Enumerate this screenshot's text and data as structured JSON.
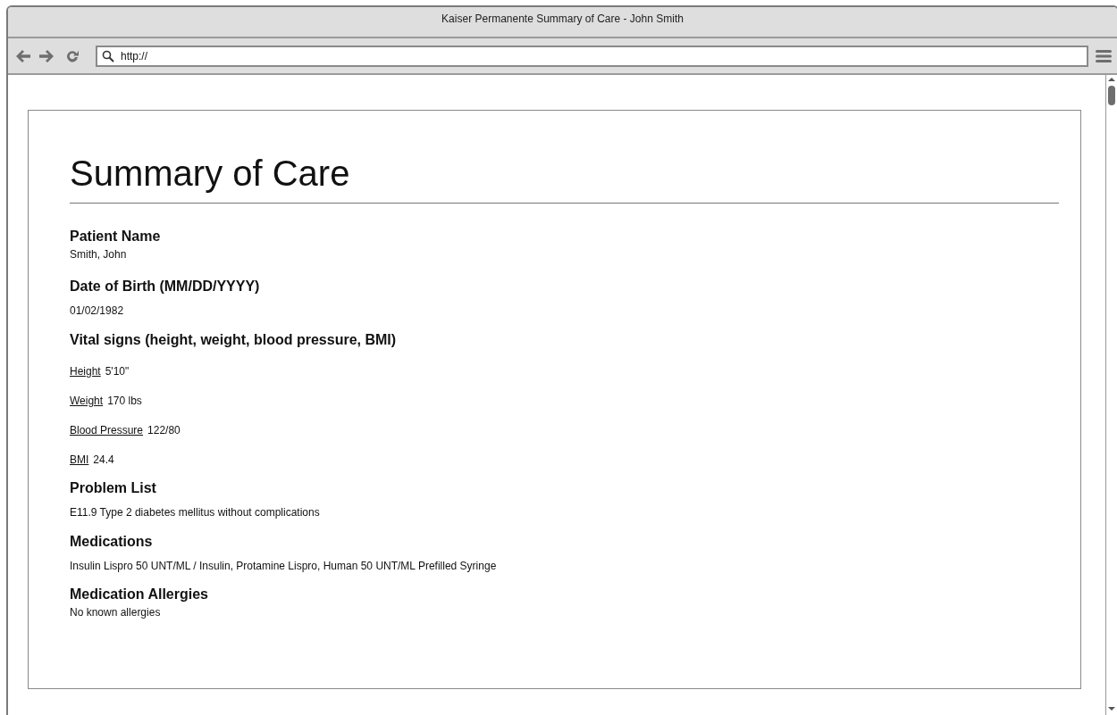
{
  "window": {
    "title": "Kaiser Permanente Summary of Care - John Smith"
  },
  "address_bar": {
    "value": "http://"
  },
  "page": {
    "title": "Summary of Care",
    "sections": [
      {
        "kind": "text",
        "heading": "Patient Name",
        "value": "Smith, John"
      },
      {
        "kind": "text",
        "heading": "Date of Birth (MM/DD/YYYY)",
        "value": "01/02/1982"
      },
      {
        "kind": "vitals",
        "heading": "Vital signs (height, weight, blood pressure, BMI)",
        "items": [
          {
            "label": "Height",
            "value": "5'10\""
          },
          {
            "label": "Weight",
            "value": "170 lbs"
          },
          {
            "label": "Blood Pressure",
            "value": "122/80"
          },
          {
            "label": "BMI",
            "value": "24.4"
          }
        ]
      },
      {
        "kind": "text",
        "heading": "Problem List",
        "value": "E11.9 Type 2 diabetes mellitus without complications"
      },
      {
        "kind": "text",
        "heading": "Medications",
        "value": "Insulin Lispro 50 UNT/ML / Insulin, Protamine Lispro, Human 50 UNT/ML Prefilled Syringe"
      },
      {
        "kind": "text",
        "heading": "Medication Allergies",
        "value": "No known allergies"
      }
    ]
  }
}
